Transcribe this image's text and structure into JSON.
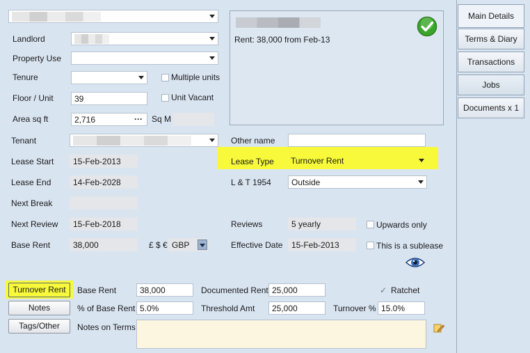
{
  "colors": {
    "background": "#d9e4f1",
    "highlight": "#f7f93a",
    "ok_green": "#3aa52b"
  },
  "top": {
    "selector_value": ""
  },
  "property": {
    "landlord_label": "Landlord",
    "property_use_label": "Property Use",
    "tenure_label": "Tenure",
    "multiple_units_label": "Multiple units",
    "floor_unit_label": "Floor / Unit",
    "floor_unit_value": "39",
    "unit_vacant_label": "Unit Vacant",
    "area_label": "Area sq ft",
    "area_value": "2,716",
    "area_button": "···",
    "sqm_label": "Sq M"
  },
  "summary": {
    "rent_text": "Rent: 38,000 from Feb-13"
  },
  "tenant": {
    "label": "Tenant",
    "other_name_label": "Other name",
    "other_name_value": ""
  },
  "lease": {
    "start_label": "Lease Start",
    "start_value": "15-Feb-2013",
    "end_label": "Lease End",
    "end_value": "14-Feb-2028",
    "next_break_label": "Next Break",
    "next_break_value": "",
    "next_review_label": "Next Review",
    "next_review_value": "15-Feb-2018",
    "base_rent_label": "Base Rent",
    "base_rent_value": "38,000",
    "currency_label": "£ $ €",
    "currency_value": "GBP",
    "type_label": "Lease Type",
    "type_value": "Turnover Rent",
    "lt_label": "L & T 1954",
    "lt_value": "Outside",
    "reviews_label": "Reviews",
    "reviews_value": "5 yearly",
    "upwards_only_label": "Upwards only",
    "effective_date_label": "Effective Date",
    "effective_date_value": "15-Feb-2013",
    "sublease_label": "This is a sublease"
  },
  "buttons": {
    "turnover_rent": "Turnover Rent",
    "notes": "Notes",
    "tags_other": "Tags/Other"
  },
  "turnover": {
    "base_rent_label": "Base Rent",
    "base_rent_value": "38,000",
    "documented_rent_label": "Documented Rent",
    "documented_rent_value": "25,000",
    "ratchet_label": "Ratchet",
    "pct_base_label": "% of Base Rent",
    "pct_base_value": "5.0%",
    "threshold_label": "Threshold Amt",
    "threshold_value": "25,000",
    "turnover_pct_label": "Turnover %",
    "turnover_pct_value": "15.0%",
    "notes_label": "Notes on Terms",
    "notes_value": ""
  },
  "tabs": [
    "Main Details",
    "Terms & Diary",
    "Transactions",
    "Jobs",
    "Documents x 1"
  ]
}
